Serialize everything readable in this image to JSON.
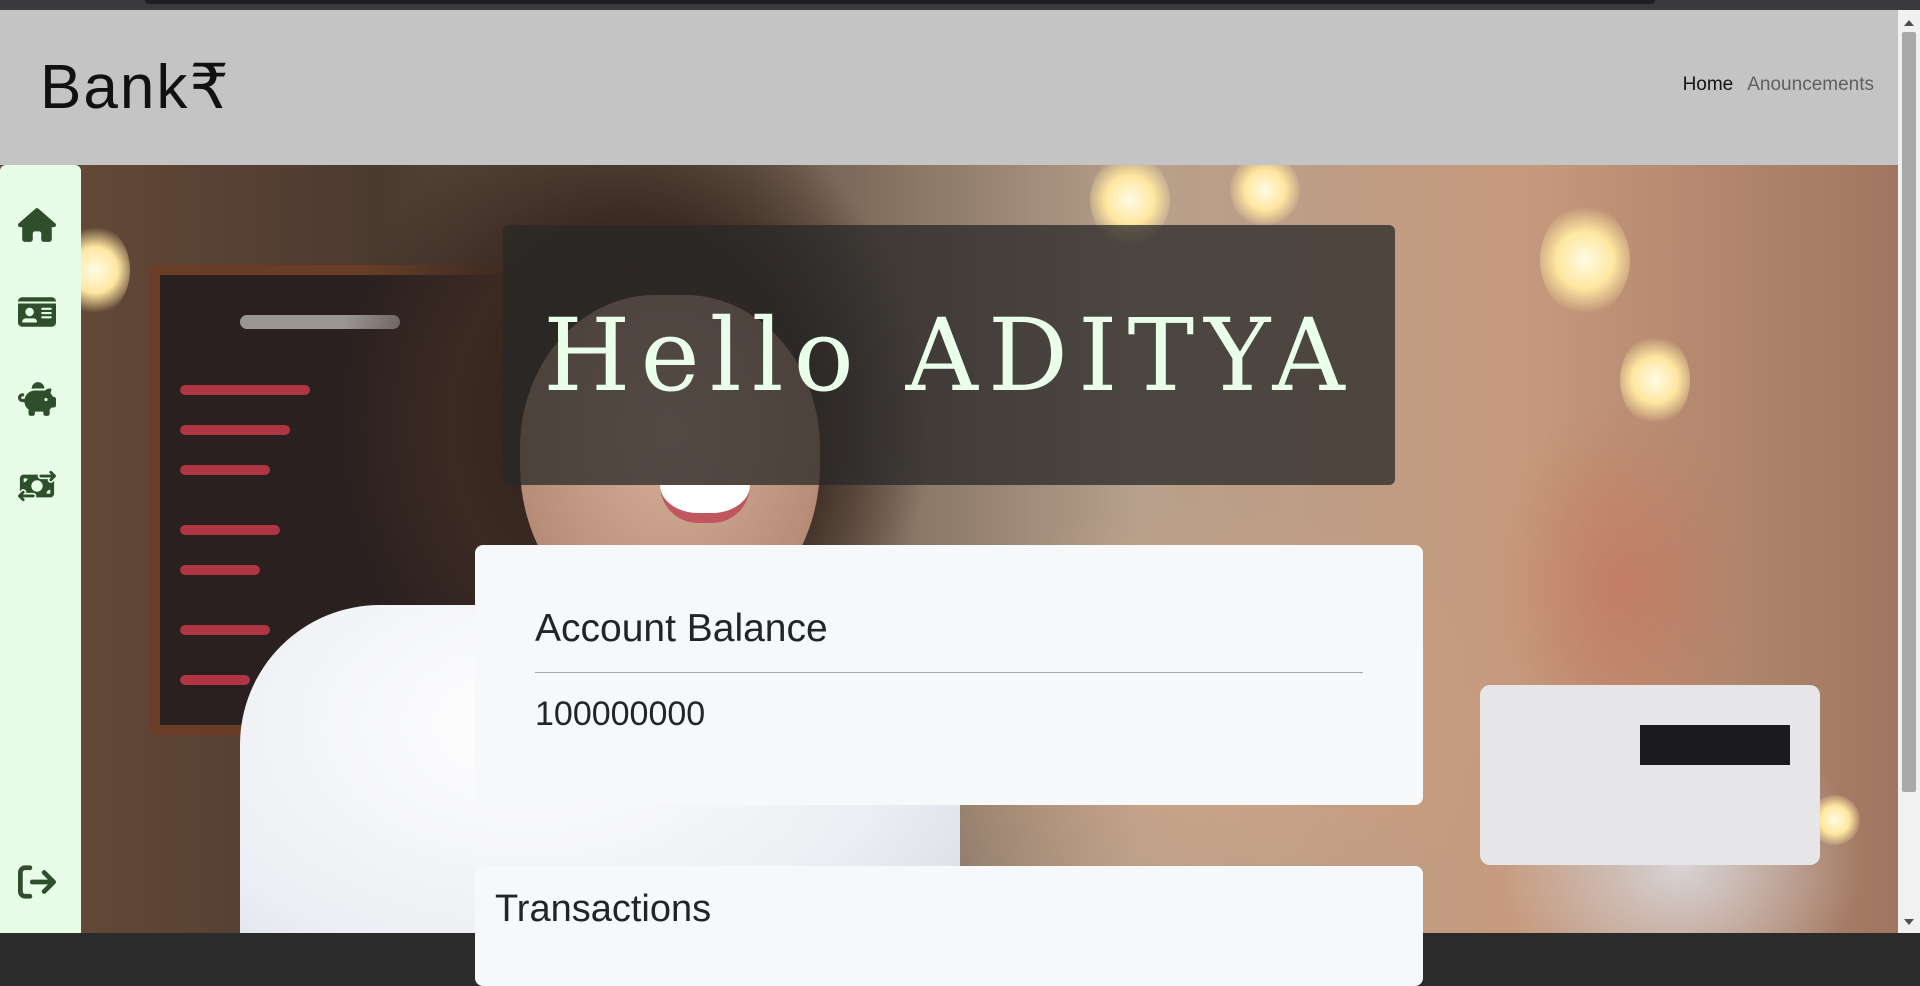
{
  "brand": {
    "name": "Bank₹"
  },
  "nav": {
    "items": [
      {
        "label": "Home",
        "active": true
      },
      {
        "label": "Anouncements",
        "active": false
      }
    ]
  },
  "sidebar": {
    "items": [
      {
        "icon": "home-icon"
      },
      {
        "icon": "id-card-icon"
      },
      {
        "icon": "piggy-bank-icon"
      },
      {
        "icon": "money-transfer-icon"
      }
    ],
    "footer_icon": "logout-icon",
    "icon_color": "#2f4f2c",
    "background": "#e8fde8"
  },
  "greeting": {
    "text": "Hello ADITYA"
  },
  "balance": {
    "title": "Account Balance",
    "value": "100000000"
  },
  "transactions": {
    "title": "Transactions"
  },
  "colors": {
    "header_bg": "#c4c4c4",
    "greeting_text": "#eaffea",
    "card_bg": "#f7f8fa"
  }
}
